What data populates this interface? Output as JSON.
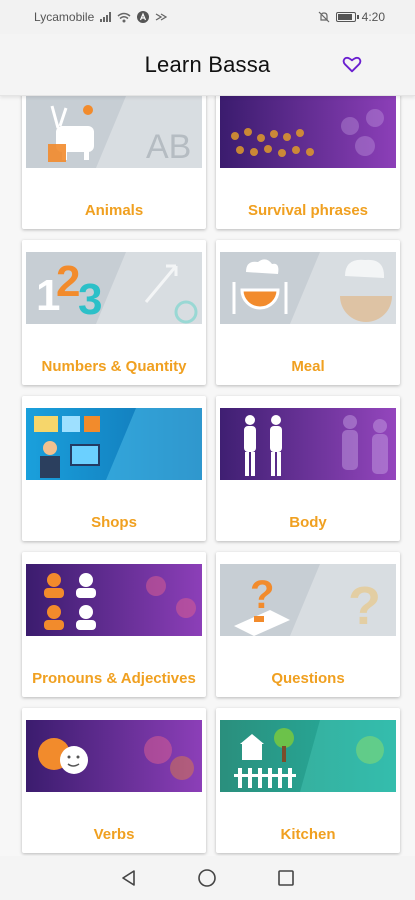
{
  "status_bar": {
    "carrier": "Lycamobile",
    "time": "4:20"
  },
  "app_bar": {
    "title": "Learn Bassa",
    "favorites_icon": "heart-outline-icon",
    "accent_color": "#6a1fd0"
  },
  "colors": {
    "label": "#f0a020",
    "purple": "#6a2c9c",
    "blue": "#1a9ad6",
    "gray": "#c9d0d6"
  },
  "categories": [
    {
      "label": "Animals",
      "theme": "gray"
    },
    {
      "label": "Survival phrases",
      "theme": "purple"
    },
    {
      "label": "Numbers & Quantity",
      "theme": "gray"
    },
    {
      "label": "Meal",
      "theme": "gray"
    },
    {
      "label": "Shops",
      "theme": "blue"
    },
    {
      "label": "Body",
      "theme": "purple"
    },
    {
      "label": "Pronouns & Adjectives",
      "theme": "purple"
    },
    {
      "label": "Questions",
      "theme": "gray"
    },
    {
      "label": "Verbs",
      "theme": "purple"
    },
    {
      "label": "Kitchen",
      "theme": "teal"
    }
  ],
  "nav_bar": {
    "back_icon": "back-triangle-icon",
    "home_icon": "home-circle-icon",
    "recents_icon": "recents-square-icon"
  }
}
